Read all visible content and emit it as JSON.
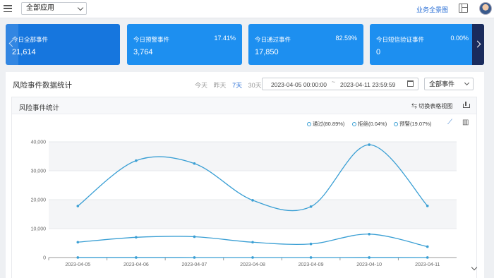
{
  "topbar": {
    "app_select": "全部应用",
    "biz_link": "业务全景图"
  },
  "cards": [
    {
      "title": "今日全部事件",
      "value": "21,614",
      "pct": ""
    },
    {
      "title": "今日预警事件",
      "value": "3,764",
      "pct": "17.41%"
    },
    {
      "title": "今日通过事件",
      "value": "17,850",
      "pct": "82.59%"
    },
    {
      "title": "今日短信验证事件",
      "value": "0",
      "pct": "0.00%"
    }
  ],
  "stats": {
    "title": "风险事件数据统计",
    "ranges": [
      "今天",
      "昨天",
      "7天",
      "30天"
    ],
    "active_range": "7天",
    "date_start": "2023-04-05 00:00:00",
    "date_sep": "~",
    "date_end": "2023-04-11 23:59:59",
    "event_select": "全部事件"
  },
  "chart_box": {
    "title": "风险事件统计",
    "switch_label": "切换表格视图",
    "legend": [
      "通过(80.89%)",
      "拒绝(0.04%)",
      "预警(19.07%)"
    ]
  },
  "colors": {
    "accent": "#1d8ff0",
    "card_active": "#1676de",
    "series": "#3a9fd4"
  },
  "chart_data": {
    "type": "line",
    "x": [
      "2023-04-05",
      "2023-04-06",
      "2023-04-07",
      "2023-04-08",
      "2023-04-09",
      "2023-04-10",
      "2023-04-11"
    ],
    "ylim": [
      0,
      40000
    ],
    "yticks": [
      0,
      10000,
      20000,
      30000,
      40000
    ],
    "ytick_labels": [
      "0",
      "10,000",
      "20,000",
      "30,000",
      "40,000"
    ],
    "grid": true,
    "legend_position": "top-right",
    "series": [
      {
        "name": "通过(80.89%)",
        "values": [
          17800,
          33500,
          32500,
          19800,
          17600,
          39000,
          17850
        ]
      },
      {
        "name": "拒绝(0.04%)",
        "values": [
          10,
          12,
          9,
          8,
          7,
          11,
          8
        ]
      },
      {
        "name": "预警(19.07%)",
        "values": [
          5300,
          7000,
          7200,
          5300,
          4700,
          8100,
          3764
        ]
      }
    ]
  }
}
